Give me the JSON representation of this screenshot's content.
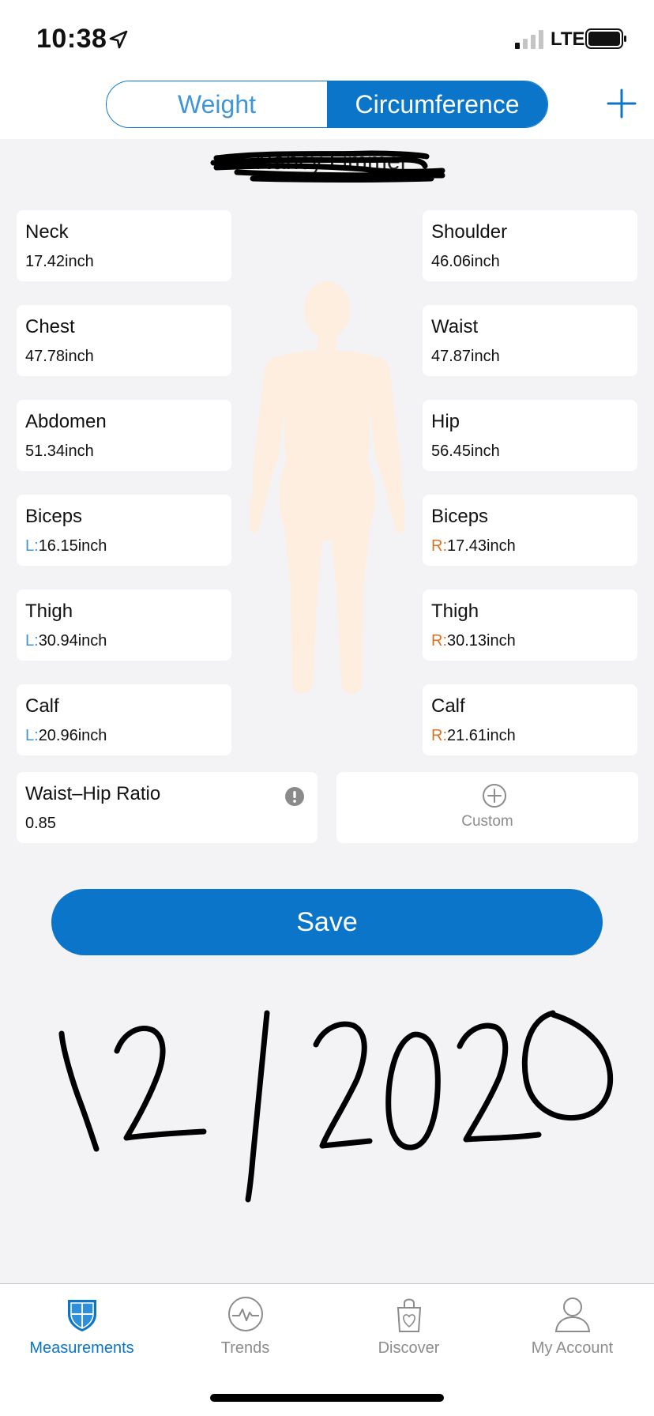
{
  "status_bar": {
    "time": "10:38",
    "carrier": "LTE",
    "location_icon": "location-arrow-icon",
    "signal_icon": "signal-bars-icon",
    "battery_icon": "battery-icon"
  },
  "nav": {
    "tabs": [
      {
        "label": "Weight",
        "selected": false
      },
      {
        "label": "Circumference",
        "selected": true
      }
    ],
    "add_icon": "plus-icon"
  },
  "profile": {
    "name": "Nancy Limmer",
    "name_redacted": true
  },
  "measurements": {
    "neck": {
      "label": "Neck",
      "value": "17.42inch"
    },
    "shoulder": {
      "label": "Shoulder",
      "value": "46.06inch"
    },
    "chest": {
      "label": "Chest",
      "value": "47.78inch"
    },
    "waist": {
      "label": "Waist",
      "value": "47.87inch"
    },
    "abdomen": {
      "label": "Abdomen",
      "value": "51.34inch"
    },
    "hip": {
      "label": "Hip",
      "value": "56.45inch"
    },
    "biceps_left": {
      "label": "Biceps",
      "prefix": "L:",
      "value": "16.15inch"
    },
    "biceps_right": {
      "label": "Biceps",
      "prefix": "R:",
      "value": "17.43inch"
    },
    "thigh_left": {
      "label": "Thigh",
      "prefix": "L:",
      "value": "30.94inch"
    },
    "thigh_right": {
      "label": "Thigh",
      "prefix": "R:",
      "value": "30.13inch"
    },
    "calf_left": {
      "label": "Calf",
      "prefix": "L:",
      "value": "20.96inch"
    },
    "calf_right": {
      "label": "Calf",
      "prefix": "R:",
      "value": "21.61inch"
    },
    "waist_hip_ratio": {
      "label": "Waist–Hip Ratio",
      "value": "0.85",
      "info_icon": "info-icon"
    }
  },
  "custom": {
    "label": "Custom",
    "icon": "plus-circle-icon"
  },
  "save_label": "Save",
  "handwritten_date": "12/2020",
  "tabbar": {
    "items": [
      {
        "label": "Measurements",
        "icon": "shield-icon",
        "active": true
      },
      {
        "label": "Trends",
        "icon": "heartbeat-icon",
        "active": false
      },
      {
        "label": "Discover",
        "icon": "shopping-bag-icon",
        "active": false
      },
      {
        "label": "My Account",
        "icon": "user-icon",
        "active": false
      }
    ]
  },
  "colors": {
    "accent": "#0a75c9",
    "left_prefix": "#3f95d6",
    "right_prefix": "#e0701e",
    "background": "#f3f2f4",
    "figure": "#fdeee0"
  }
}
